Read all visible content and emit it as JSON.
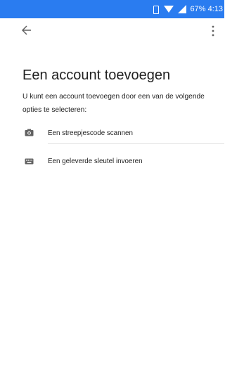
{
  "status_bar": {
    "battery": "67%",
    "time": "4:13",
    "icons": [
      "vibrate-icon",
      "wifi-icon",
      "signal-icon"
    ],
    "background": "#2a7cf0"
  },
  "toolbar": {
    "back_icon": "back-arrow-icon",
    "menu_icon": "more-vert-icon"
  },
  "page": {
    "title": "Een account toevoegen",
    "subtitle": "U kunt een account toevoegen door een van de volgende opties te selecteren:"
  },
  "options": [
    {
      "label": "Een streepjescode scannen",
      "icon": "camera-icon"
    },
    {
      "label": "Een geleverde sleutel invoeren",
      "icon": "keyboard-icon"
    }
  ]
}
